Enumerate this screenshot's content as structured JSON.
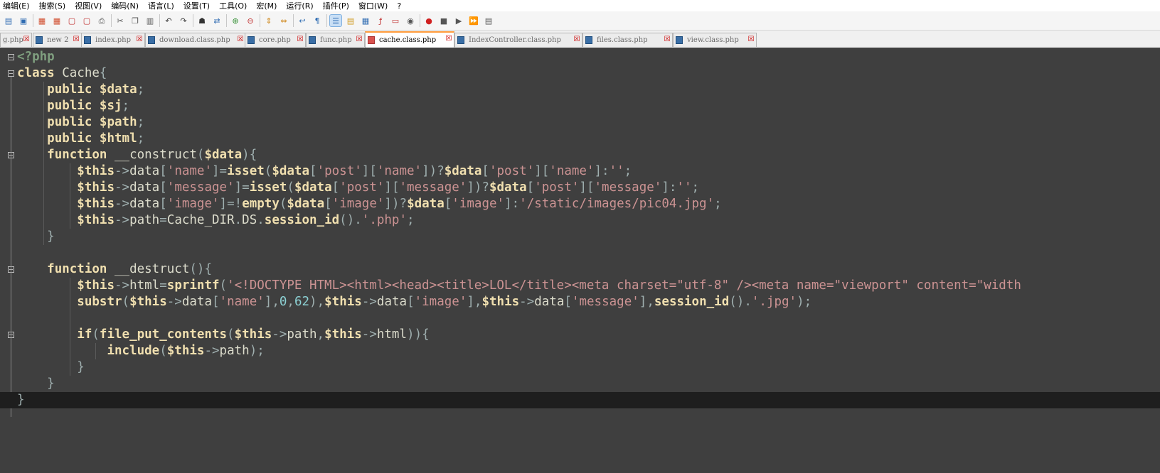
{
  "menu": [
    "编辑(E)",
    "搜索(S)",
    "视图(V)",
    "编码(N)",
    "语言(L)",
    "设置(T)",
    "工具(O)",
    "宏(M)",
    "运行(R)",
    "插件(P)",
    "窗口(W)",
    "?"
  ],
  "toolbar_icons": [
    "new-file-icon",
    "open-file-icon",
    "save-icon",
    "save-all-icon",
    "close-icon",
    "close-all-icon",
    "print-icon",
    "cut-icon",
    "copy-icon",
    "paste-icon",
    "undo-icon",
    "redo-icon",
    "find-icon",
    "replace-icon",
    "zoom-in-icon",
    "zoom-out-icon",
    "sync-vertical-icon",
    "sync-horizontal-icon",
    "word-wrap-icon",
    "show-all-chars-icon",
    "indent-guide-icon",
    "user-lang-icon",
    "doc-map-icon",
    "function-list-icon",
    "folder-workspace-icon",
    "monitoring-icon",
    "record-macro-icon",
    "stop-macro-icon",
    "play-macro-icon",
    "run-macro-multiple-icon",
    "save-macro-icon"
  ],
  "tabs": [
    {
      "label": "g.php",
      "state": "none"
    },
    {
      "label": "new 2",
      "state": "saved"
    },
    {
      "label": "index.php",
      "state": "saved"
    },
    {
      "label": "download.class.php",
      "state": "saved"
    },
    {
      "label": "core.php",
      "state": "saved"
    },
    {
      "label": "func.php",
      "state": "saved"
    },
    {
      "label": "cache.class.php",
      "state": "unsaved",
      "active": true
    },
    {
      "label": "IndexController.class.php",
      "state": "saved"
    },
    {
      "label": "files.class.php",
      "state": "saved"
    },
    {
      "label": "view.class.php",
      "state": "saved"
    }
  ],
  "code": [
    "<?php",
    "class Cache{",
    "    public $data;",
    "    public $sj;",
    "    public $path;",
    "    public $html;",
    "    function __construct($data){",
    "        $this->data['name']=isset($data['post']['name'])?$data['post']['name']:'';",
    "        $this->data['message']=isset($data['post']['message'])?$data['post']['message']:'';",
    "        $this->data['image']=!empty($data['image'])?$data['image']:'/static/images/pic04.jpg';",
    "        $this->path=Cache_DIR.DS.session_id().'.php';",
    "    }",
    "",
    "    function __destruct(){",
    "        $this->html=sprintf('<!DOCTYPE HTML><html><head><title>LOL</title><meta charset=\"utf-8\" /><meta name=\"viewport\" content=\"width",
    "        substr($this->data['name'],0,62),$this->data['image'],$this->data['message'],session_id().'.jpg');",
    "",
    "        if(file_put_contents($this->path,$this->html)){",
    "            include($this->path);",
    "        }",
    "    }",
    "}"
  ],
  "current_line": 22,
  "theme": {
    "background": "#3f3f3f",
    "current_line": "#1e1e1e",
    "keyword": "#f0dfaf",
    "string": "#cc9393",
    "number": "#8cd0d3",
    "tag": "#7f9f7f",
    "tab_accent": "#ff9c3c"
  }
}
